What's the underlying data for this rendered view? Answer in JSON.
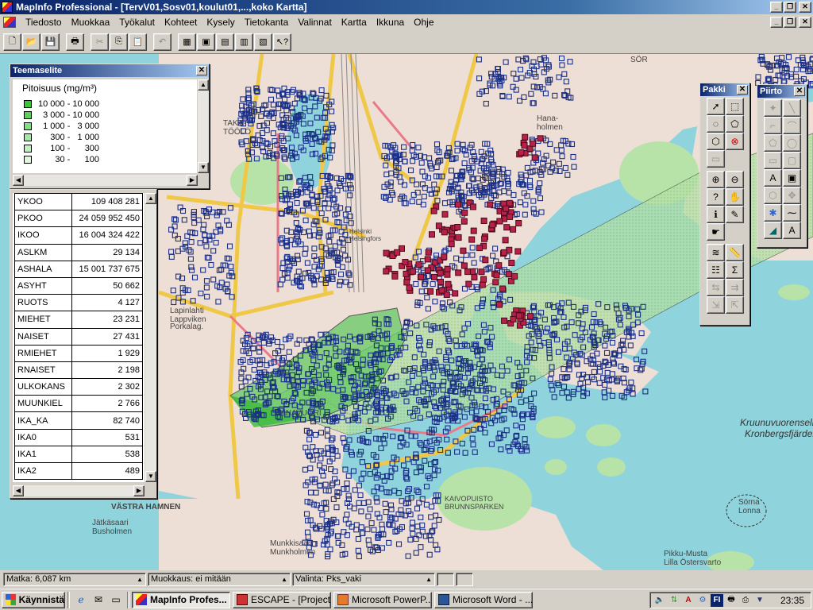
{
  "app": {
    "title": "MapInfo Professional - [TervV01,Sosv01,koulut01,...,koko Kartta]"
  },
  "menu": {
    "items": [
      "Tiedosto",
      "Muokkaa",
      "Työkalut",
      "Kohteet",
      "Kysely",
      "Tietokanta",
      "Valinnat",
      "Kartta",
      "Ikkuna",
      "Ohje"
    ]
  },
  "toolbar": {
    "buttons": [
      "new",
      "open",
      "save",
      "print",
      "cut",
      "copy",
      "paste",
      "undo",
      "new-browser",
      "new-map",
      "new-graph",
      "new-layout",
      "redistrict",
      "help"
    ]
  },
  "legend_window": {
    "title": "Teemaselite",
    "heading": "Pitoisuus (mg/m³)",
    "ranges": [
      {
        "label": "10 000 - 10 000",
        "color": "#3cc43c"
      },
      {
        "label": "  3 000 - 10 000",
        "color": "#5ad05a"
      },
      {
        "label": "  1 000 -   3 000",
        "color": "#86dc86"
      },
      {
        "label": "     300 -   1 000",
        "color": "#a6e6a6"
      },
      {
        "label": "     100 -      300",
        "color": "#c4eec4"
      },
      {
        "label": "       30 -      100",
        "color": "#e0f6e0"
      }
    ]
  },
  "info_window": {
    "rows": [
      {
        "field": "YKOO",
        "value": "109 408 281"
      },
      {
        "field": "PKOO",
        "value": "24 059 952 450"
      },
      {
        "field": "IKOO",
        "value": "16 004 324 422"
      },
      {
        "field": "ASLKM",
        "value": "29 134"
      },
      {
        "field": "ASHALA",
        "value": "15 001 737 675"
      },
      {
        "field": "ASYHT",
        "value": "50 662"
      },
      {
        "field": "RUOTS",
        "value": "4 127"
      },
      {
        "field": "MIEHET",
        "value": "23 231"
      },
      {
        "field": "NAISET",
        "value": "27 431"
      },
      {
        "field": "RMIEHET",
        "value": "1 929"
      },
      {
        "field": "RNAISET",
        "value": "2 198"
      },
      {
        "field": "ULKOKANS",
        "value": "2 302"
      },
      {
        "field": "MUUNKIEL",
        "value": "2 766"
      },
      {
        "field": "IKA_KA",
        "value": "82 740"
      },
      {
        "field": "IKA0",
        "value": "531"
      },
      {
        "field": "IKA1",
        "value": "538"
      },
      {
        "field": "IKA2",
        "value": "489"
      }
    ]
  },
  "pakki": {
    "title": "Pakki"
  },
  "piirto": {
    "title": "Piirto"
  },
  "map_labels": {
    "taka_tooloo": "TAKA-\nTÖÖLÖ",
    "lapinlahti": "Lapinlahti\nLappviken",
    "vastra_hamnen": "VÄSTRA HAMNEN",
    "jatkasaari": "Jätkäsaari\nBusholmen",
    "munkkisaari": "Munkkisaari\nMunkholmen",
    "punavuori": "PUNAVUORI",
    "kruunuvuorenselka": "Kruunuvuorenselkä\nKronbergsfjärden",
    "sorna": "Sörna\nLonna",
    "hanasaari": "Hana-\nholmen",
    "kaivopuisto": "KAIVOPUISTO\nBRUNNSPARKEN",
    "pikkumusta": "Pikku-Musta\nLilla Östersvarto",
    "sorn": "SÖR",
    "porkala": "Porkalag.",
    "helsinki": "Helsinki\nHelsingfors"
  },
  "status": {
    "distance": "Matka: 6,087 km",
    "editing": "Muokkaus: ei mitään",
    "selection": "Valinta: Pks_vaki"
  },
  "taskbar": {
    "start": "Käynnistä",
    "tasks": [
      {
        "label": "MapInfo Profes...",
        "active": true
      },
      {
        "label": "ESCAPE - [Project]",
        "active": false
      },
      {
        "label": "Microsoft PowerP...",
        "active": false
      },
      {
        "label": "Microsoft Word - ...",
        "active": false
      }
    ],
    "tray_lang": "FI",
    "clock": "23:35"
  }
}
